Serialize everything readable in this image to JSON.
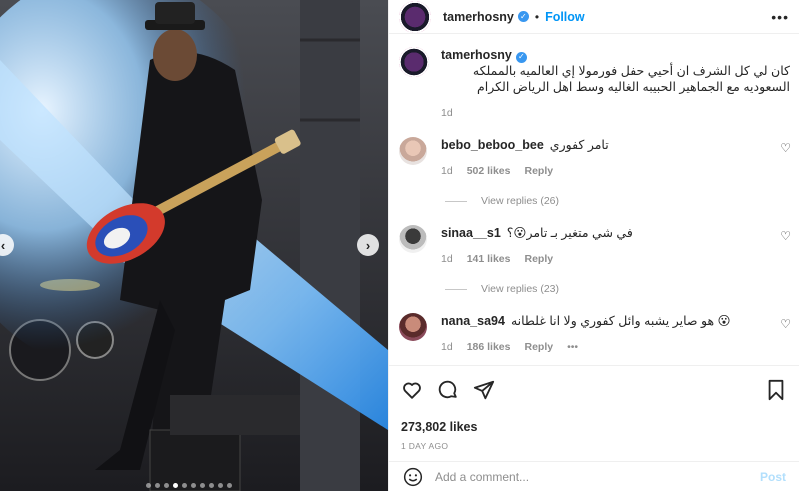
{
  "header": {
    "username": "tamerhosny",
    "separator": "•",
    "follow_label": "Follow",
    "more_label": "•••"
  },
  "caption": {
    "username": "tamerhosny",
    "text": "كان لي كل الشرف ان أحيي حفل فورمولا إي العالميه بالمملكه السعوديه مع الجماهير الحبيبه الغاليه وسط اهل الرياض الكرام",
    "time": "1d"
  },
  "comments": [
    {
      "username": "bebo_beboo_bee",
      "text": "تامر كفوري",
      "time": "1d",
      "likes": "502 likes",
      "reply": "Reply",
      "view_replies": "View replies (26)"
    },
    {
      "username": "sinaa__s1",
      "text": "في شي متغير بـ تامر😮؟",
      "time": "1d",
      "likes": "141 likes",
      "reply": "Reply",
      "view_replies": "View replies (23)"
    },
    {
      "username": "nana_sa94",
      "text": "هو صاير يشبه وائل كفوري ولا انا غلطانه 😮",
      "time": "1d",
      "likes": "186 likes",
      "reply": "Reply"
    }
  ],
  "actions": {
    "likes": "273,802 likes",
    "ago": "1 DAY AGO"
  },
  "add_comment": {
    "placeholder": "Add a comment...",
    "post_label": "Post"
  },
  "icons": [
    "heart-icon",
    "comment-icon",
    "share-icon",
    "bookmark-icon",
    "emoji-icon",
    "verified-icon",
    "chevron-left-icon",
    "chevron-right-icon",
    "more-icon"
  ],
  "colors": {
    "link_blue": "#0095f6",
    "muted": "#8e8e8e",
    "verified": "#3897f0",
    "post_disabled": "#b2dffc"
  }
}
